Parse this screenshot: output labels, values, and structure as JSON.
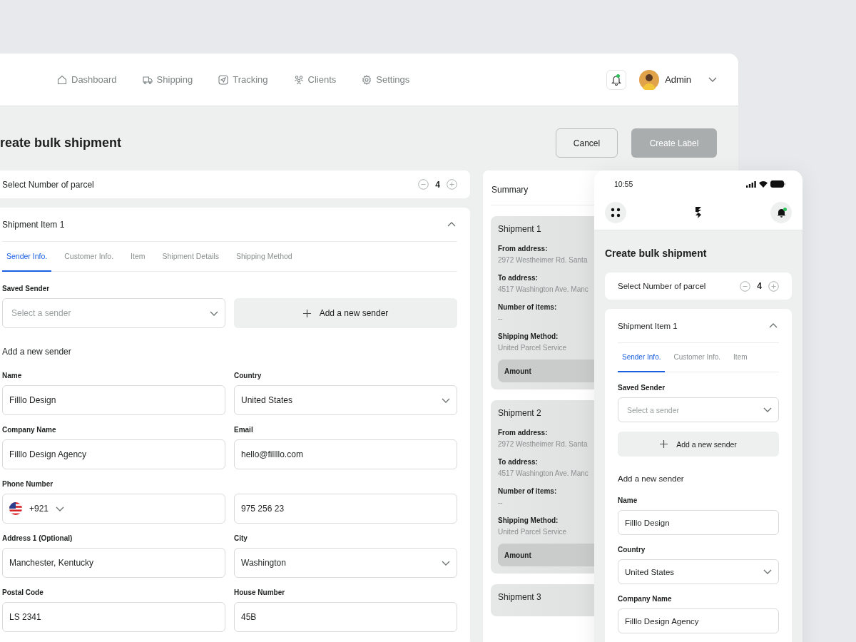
{
  "desktop": {
    "nav": [
      {
        "label": "Dashboard",
        "kind": "home"
      },
      {
        "label": "Shipping",
        "kind": "truck"
      },
      {
        "label": "Tracking",
        "kind": "send"
      },
      {
        "label": "Clients",
        "kind": "users"
      },
      {
        "label": "Settings",
        "kind": "gear"
      }
    ],
    "notification_dot": true,
    "user": "Admin",
    "title": "reate bulk shipment",
    "actions": [
      {
        "label": "Cancel",
        "kind": "secondary",
        "disabled": false
      },
      {
        "label": "Create Label",
        "kind": "primary",
        "disabled": true
      }
    ],
    "parcel": {
      "label": "Select Number of parcel",
      "count": "4"
    },
    "item": {
      "title": "Shipment Item 1",
      "expanded": true,
      "tabs": [
        {
          "label": "Sender Info.",
          "selected": true
        },
        {
          "label": "Customer Info.",
          "selected": false
        },
        {
          "label": "Item",
          "selected": false
        },
        {
          "label": "Shipment Details",
          "selected": false
        },
        {
          "label": "Shipping Method",
          "selected": false
        }
      ],
      "saved_sender": {
        "label": "Saved Sender",
        "placeholder": "Select a sender"
      },
      "add_button": "Add a new sender",
      "section": "Add a new sender",
      "fields": [
        {
          "label": "Name",
          "value": "Filllo Design",
          "kind": "text"
        },
        {
          "label": "Country",
          "value": "United States",
          "kind": "select"
        },
        {
          "label": "Company Name",
          "value": "Filllo Design Agency",
          "kind": "text"
        },
        {
          "label": "Email",
          "value": "hello@fillllo.com",
          "kind": "text"
        },
        {
          "label": "Phone Number",
          "value": "+921",
          "kind": "phone"
        },
        {
          "value": "975 256 23",
          "kind": "text"
        },
        {
          "label": "Address 1 (Optional)",
          "value": "Manchester, Kentucky",
          "kind": "text"
        },
        {
          "label": "City",
          "value": "Washington",
          "kind": "select"
        },
        {
          "label": "Postal Code",
          "value": "LS 2341",
          "kind": "text"
        },
        {
          "label": "House Number",
          "value": "45B",
          "kind": "text"
        }
      ]
    },
    "summary": {
      "title": "Summary",
      "shipments": [
        {
          "title": "Shipment 1",
          "rows": [
            {
              "label": "From address:",
              "value": "2972 Westheimer Rd. Santa"
            },
            {
              "label": "To address:",
              "value": "4517 Washington Ave. Manc"
            },
            {
              "label": "Number of items:",
              "value": "--"
            },
            {
              "label": "Shipping Method:",
              "value": "United Parcel Service"
            }
          ],
          "amount": "Amount"
        },
        {
          "title": "Shipment 2",
          "rows": [
            {
              "label": "From address:",
              "value": "2972 Westheimer Rd. Santa"
            },
            {
              "label": "To address:",
              "value": "4517 Washington Ave. Manc"
            },
            {
              "label": "Number of items:",
              "value": "--"
            },
            {
              "label": "Shipping Method:",
              "value": "United Parcel Service"
            }
          ],
          "amount": "Amount"
        },
        {
          "title": "Shipment 3"
        }
      ]
    }
  },
  "phone": {
    "time": "10:55",
    "notification_dot": true,
    "title": "Create bulk shipment",
    "parcel": {
      "label": "Select Number of parcel",
      "count": "4"
    },
    "item": {
      "title": "Shipment Item 1",
      "expanded": true,
      "tabs": [
        {
          "label": "Sender Info.",
          "selected": true
        },
        {
          "label": "Customer Info.",
          "selected": false
        },
        {
          "label": "Item",
          "selected": false
        }
      ],
      "saved_sender": {
        "label": "Saved Sender",
        "placeholder": "Select a sender"
      },
      "add_button": "Add a new sender",
      "section": "Add a new sender",
      "fields": [
        {
          "label": "Name",
          "value": "Filllo Design",
          "kind": "text"
        },
        {
          "label": "Country",
          "value": "United States",
          "kind": "select"
        },
        {
          "label": "Company Name",
          "value": "Filllo Design Agency",
          "kind": "text"
        }
      ]
    }
  }
}
